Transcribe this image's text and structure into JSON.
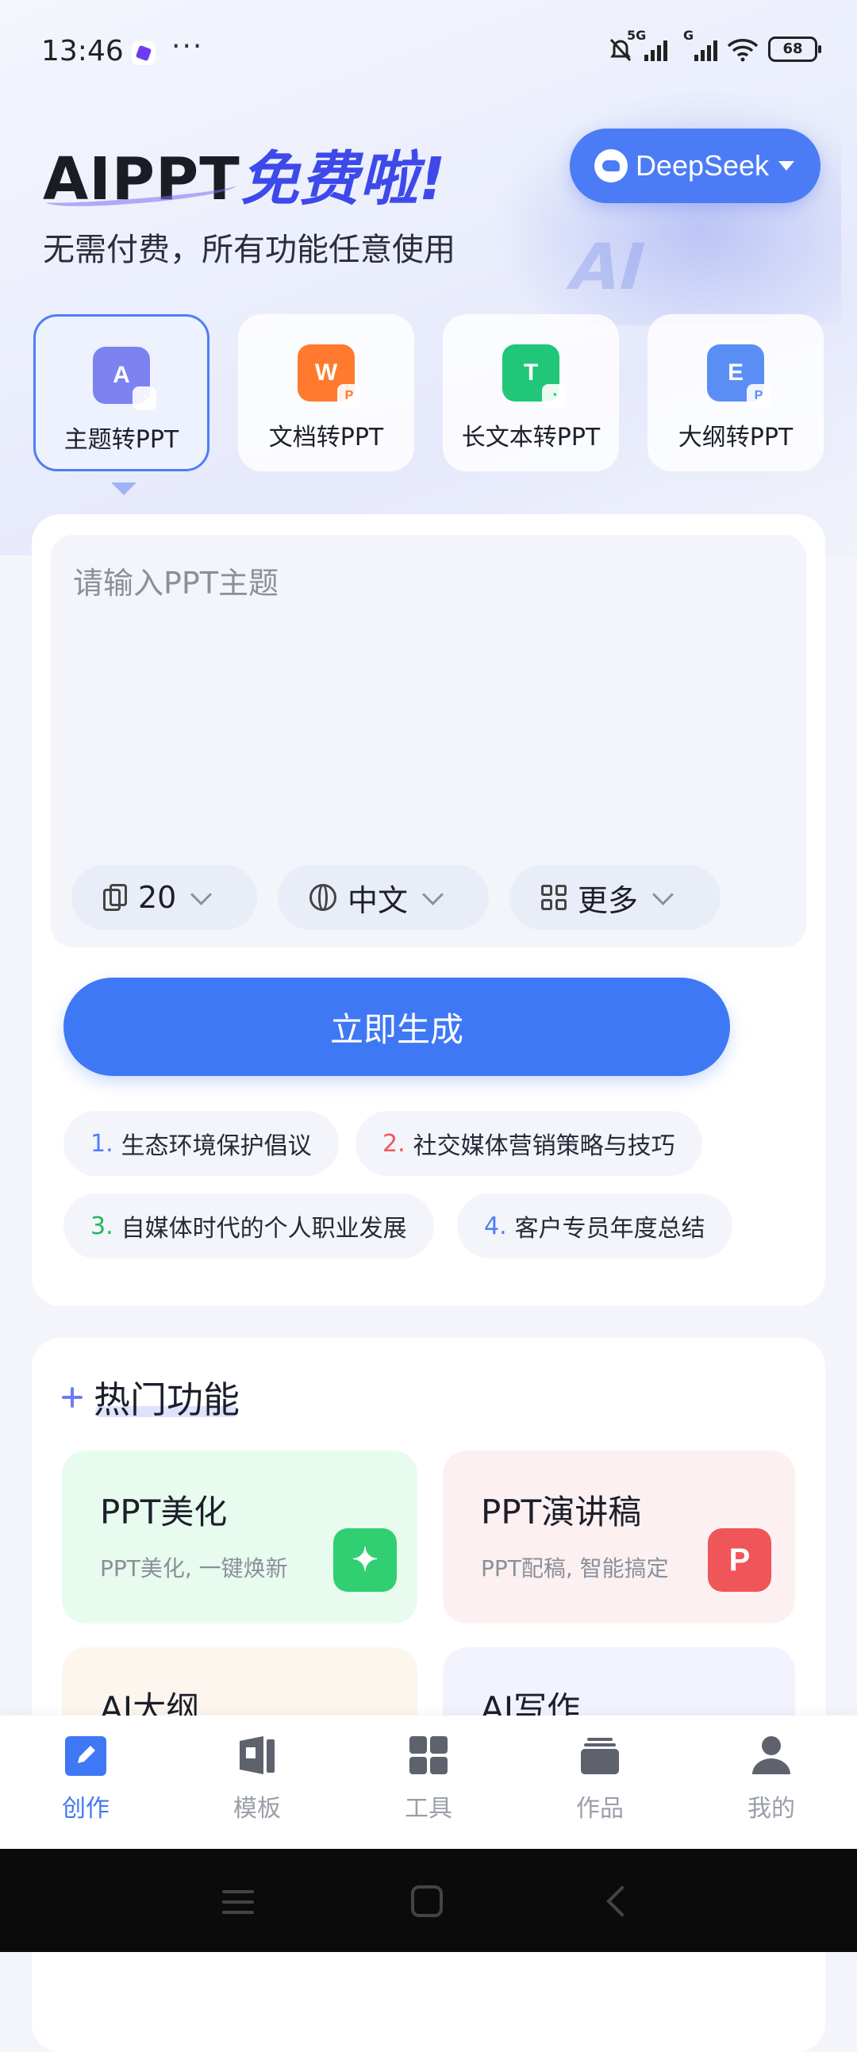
{
  "status_bar": {
    "time": "13:46",
    "more": "···",
    "net1": "5G",
    "net2": "G",
    "battery": "68"
  },
  "hero": {
    "title_a": "AIPPT",
    "title_b": "免费啦!",
    "subtitle": "无需付费，所有功能任意使用",
    "deco_text": "AI",
    "model_button": "DeepSeek"
  },
  "modes": [
    {
      "label": "主题转PPT",
      "icon_letter": "A",
      "icon_color": "#7c82f0"
    },
    {
      "label": "文档转PPT",
      "icon_letter": "W",
      "icon_color": "#ff7a2e"
    },
    {
      "label": "长文本转PPT",
      "icon_letter": "T",
      "icon_color": "#22c678"
    },
    {
      "label": "大纲转PPT",
      "icon_letter": "E",
      "icon_color": "#5b8ef5"
    }
  ],
  "input": {
    "placeholder": "请输入PPT主题",
    "pages": "20",
    "language": "中文",
    "more": "更多",
    "generate": "立即生成"
  },
  "suggestions": [
    {
      "num": "1.",
      "text": "生态环境保护倡议",
      "color": "#4d7ff4"
    },
    {
      "num": "2.",
      "text": "社交媒体营销策略与技巧",
      "color": "#f0565c"
    },
    {
      "num": "3.",
      "text": "自媒体时代的个人职业发展",
      "color": "#22b85e"
    },
    {
      "num": "4.",
      "text": "客户专员年度总结",
      "color": "#4d7ff4"
    }
  ],
  "hot": {
    "title": "热门功能",
    "items": [
      {
        "title": "PPT美化",
        "subtitle": "PPT美化, 一键焕新",
        "bg": "#e8fbef"
      },
      {
        "title": "PPT演讲稿",
        "subtitle": "PPT配稿, 智能搞定",
        "bg": "#fdf0f1"
      },
      {
        "title": "AI大纲",
        "subtitle": "",
        "bg": "#fdf6ee"
      },
      {
        "title": "AI写作",
        "subtitle": "",
        "bg": "#f2f3fd"
      }
    ]
  },
  "nav": [
    {
      "label": "创作",
      "icon": "pencil-icon",
      "active": true
    },
    {
      "label": "模板",
      "icon": "template-icon",
      "active": false
    },
    {
      "label": "工具",
      "icon": "grid-icon",
      "active": false
    },
    {
      "label": "作品",
      "icon": "stack-icon",
      "active": false
    },
    {
      "label": "我的",
      "icon": "person-icon",
      "active": false
    }
  ]
}
